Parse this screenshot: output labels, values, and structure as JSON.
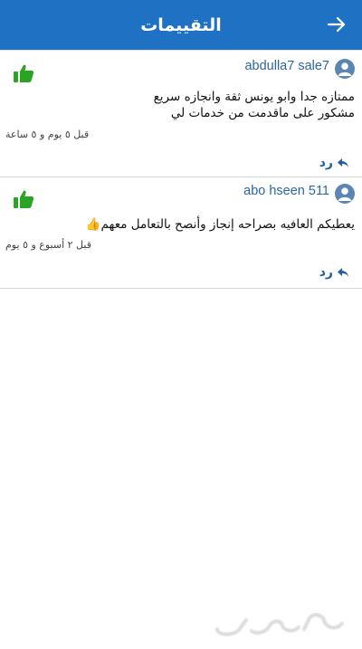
{
  "header": {
    "title": "التقييمات",
    "back_icon": "arrow-right-icon"
  },
  "colors": {
    "header_bg": "#1f72c3",
    "username": "#2a66a6",
    "thumb": "#2aa523",
    "reply": "#1f5fa8"
  },
  "reviews": [
    {
      "username": "abdulla7 sale7",
      "text_line1": "ممتازه جدا  وابو يونس ثقة وانجازه سريع",
      "text_line2": "مشكور على ماقدمت من خدمات لي",
      "timestamp": "قبل ٥ يوم و ٥ ساعة",
      "reply_label": "رد",
      "rating_icon": "thumbs-up-icon"
    },
    {
      "username": "abo hseen 511",
      "text_line1": "يعطيكم العافيه بصراحه إنجاز وأنصح بالتعامل معهم👍",
      "timestamp": "قبل ٢ أسبوع و ٥ يوم",
      "reply_label": "رد",
      "rating_icon": "thumbs-up-icon"
    }
  ],
  "watermark": "حراج"
}
